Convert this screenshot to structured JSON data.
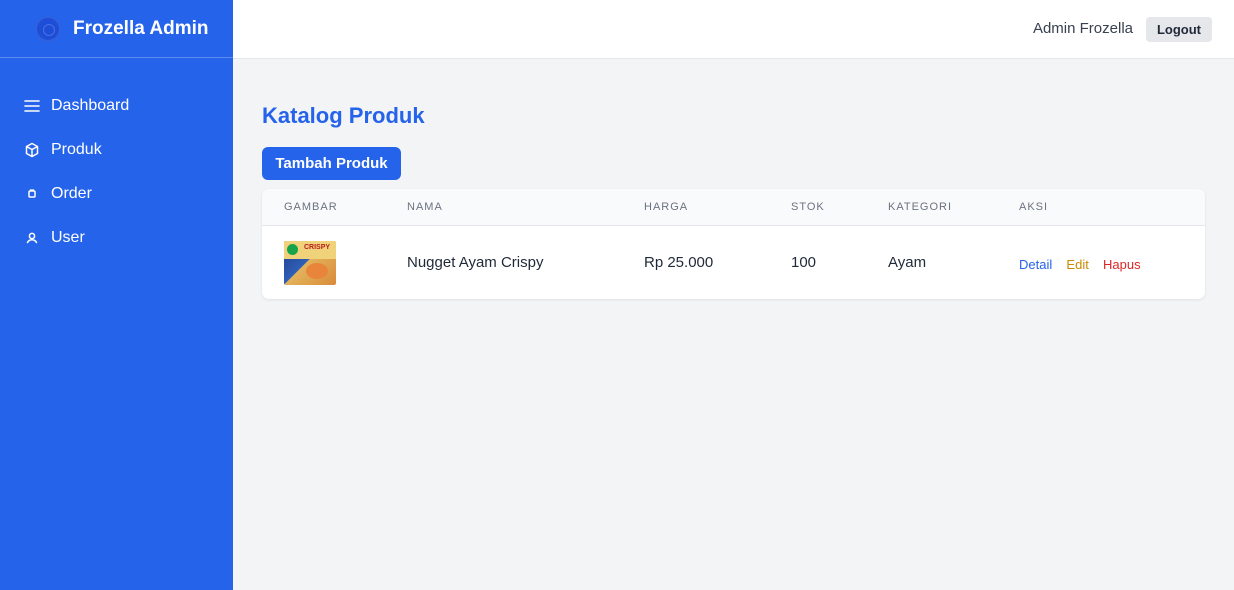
{
  "brand": {
    "title": "Frozella Admin"
  },
  "sidebar": {
    "items": [
      {
        "label": "Dashboard",
        "icon": "menu-icon"
      },
      {
        "label": "Produk",
        "icon": "cube-icon"
      },
      {
        "label": "Order",
        "icon": "order-icon"
      },
      {
        "label": "User",
        "icon": "user-icon"
      }
    ]
  },
  "header": {
    "admin_name": "Admin Frozella",
    "logout_label": "Logout"
  },
  "main": {
    "title": "Katalog Produk",
    "add_button_label": "Tambah Produk",
    "table": {
      "columns": [
        "GAMBAR",
        "NAMA",
        "HARGA",
        "STOK",
        "KATEGORI",
        "AKSI"
      ],
      "rows": [
        {
          "image_label": "CRISPY",
          "nama": "Nugget Ayam Crispy",
          "harga": "Rp 25.000",
          "stok": "100",
          "kategori": "Ayam",
          "actions": {
            "detail": "Detail",
            "edit": "Edit",
            "hapus": "Hapus"
          }
        }
      ]
    }
  },
  "colors": {
    "primary": "#2563eb",
    "background": "#f3f4f6",
    "edit": "#ca8a04",
    "delete": "#dc2626"
  }
}
